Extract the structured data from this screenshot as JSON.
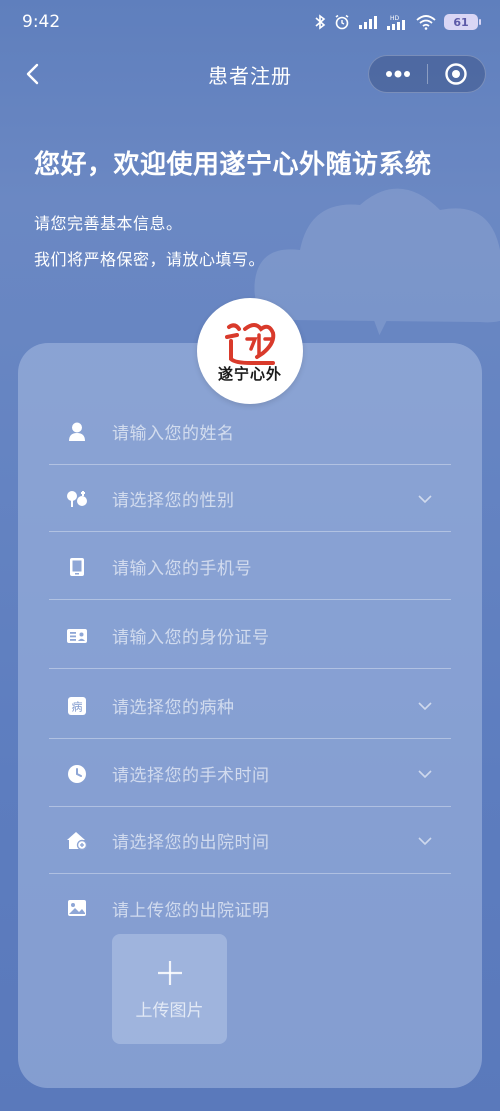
{
  "status_bar": {
    "time": "9:42",
    "battery": "61"
  },
  "nav": {
    "title": "患者注册"
  },
  "welcome": {
    "title": "您好，欢迎使用遂宁心外随访系统",
    "line1": "请您完善基本信息。",
    "line2": "我们将严格保密，请放心填写。"
  },
  "logo": {
    "text": "遂宁心外"
  },
  "form": {
    "name_placeholder": "请输入您的姓名",
    "gender_placeholder": "请选择您的性别",
    "phone_placeholder": "请输入您的手机号",
    "id_placeholder": "请输入您的身份证号",
    "disease_placeholder": "请选择您的病种",
    "surgery_time_placeholder": "请选择您的手术时间",
    "discharge_time_placeholder": "请选择您的出院时间",
    "discharge_proof_label": "请上传您的出院证明",
    "upload_label": "上传图片",
    "disease_icon_char": "病"
  },
  "colors": {
    "background": "#6584c2",
    "card": "#a8bce1",
    "logo_red": "#d93a2b"
  }
}
